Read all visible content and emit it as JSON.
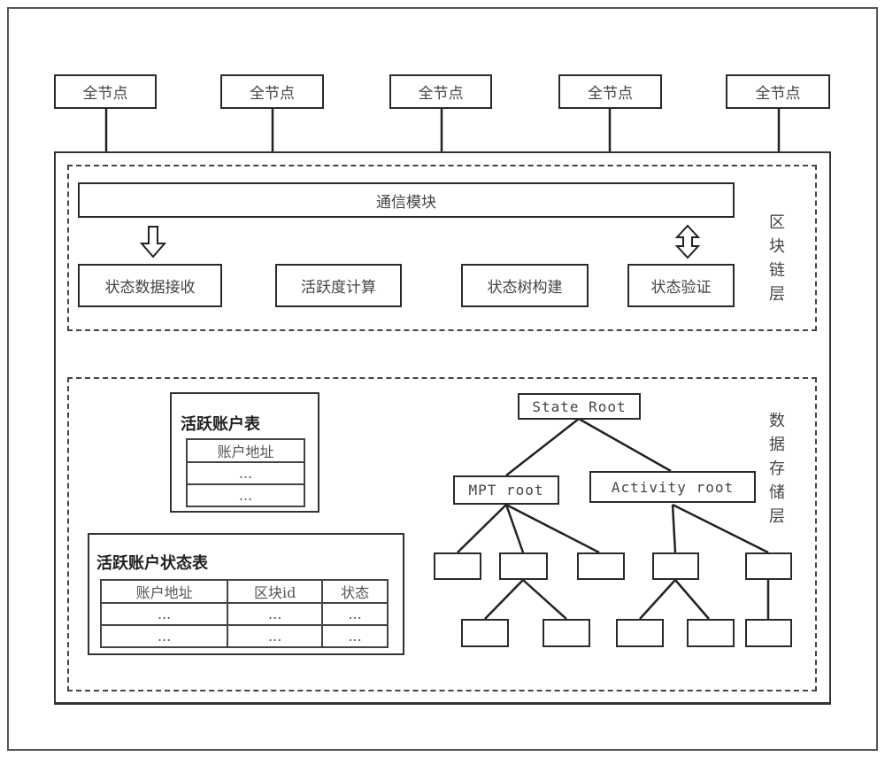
{
  "full_nodes": [
    "全节点",
    "全节点",
    "全节点",
    "全节点",
    "全节点"
  ],
  "blockchain_layer": {
    "label": "区\n块\n链\n层",
    "label_chars": [
      "区",
      "块",
      "链",
      "层"
    ],
    "comm_module": "通信模块",
    "modules": [
      "状态数据接收",
      "活跃度计算",
      "状态树构建",
      "状态验证"
    ],
    "arrows": {
      "down_to": "状态数据接收",
      "bidirectional_with": "状态验证"
    }
  },
  "storage_layer": {
    "label_chars": [
      "数",
      "据",
      "存",
      "储",
      "层"
    ],
    "active_account_table": {
      "title": "活跃账户表",
      "header": "账户地址",
      "rows": [
        "...",
        "..."
      ]
    },
    "active_account_state_table": {
      "title": "活跃账户状态表",
      "headers": [
        "账户地址",
        "区块id",
        "状态"
      ],
      "rows": [
        [
          "...",
          "...",
          "..."
        ],
        [
          "...",
          "...",
          "..."
        ]
      ]
    },
    "tree": {
      "root": "State Root",
      "children": [
        "MPT root",
        "Activity root"
      ],
      "mpt_children": 3,
      "mpt_grandchildren_under_second": 2,
      "activity_children": 2,
      "activity_grandchildren": [
        2,
        1
      ]
    }
  }
}
